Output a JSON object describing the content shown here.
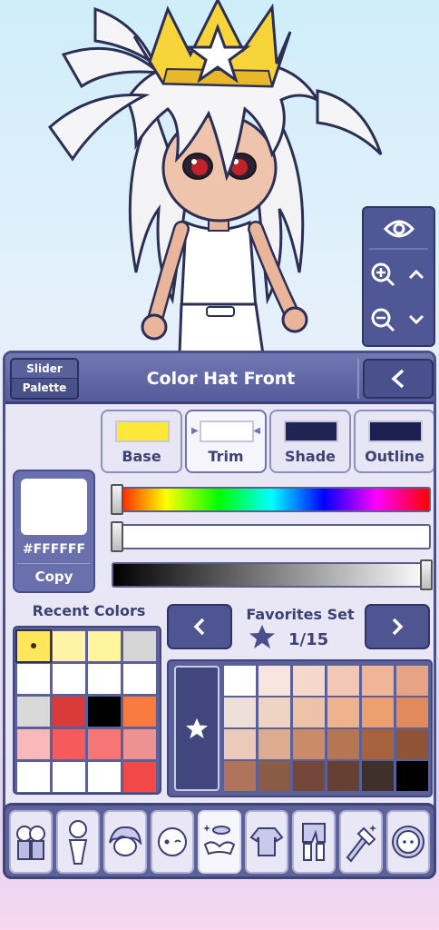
{
  "view_controls": {
    "icons": [
      "eye-icon",
      "zoom-in-icon",
      "chevron-up-icon",
      "zoom-out-icon",
      "chevron-down-icon"
    ]
  },
  "panel": {
    "mode_toggle": {
      "option_top": "Slider",
      "option_bottom": "Palette"
    },
    "title": "Color Hat Front",
    "back_icon": "chevron-left-icon",
    "part_tabs": [
      {
        "label": "Base",
        "color": "#FFE83A"
      },
      {
        "label": "Trim",
        "color": "#FFFFFF"
      },
      {
        "label": "Shade",
        "color": "#1F2550"
      },
      {
        "label": "Outline",
        "color": "#1C2050"
      }
    ],
    "active_part": "Trim",
    "current_color": {
      "hex": "#FFFFFF",
      "copy_label": "Copy"
    },
    "sliders": {
      "hue": 0,
      "saturation": 0,
      "value": 100
    },
    "recent": {
      "title": "Recent Colors",
      "colors": [
        "#FFE65A",
        "#FFF3A8",
        "#FFF59C",
        "#D6D6D6",
        "#FFFFFF",
        "#FFFFFF",
        "#FFFFFF",
        "#FFFFFF",
        "#D9D9D9",
        "#D93B3B",
        "#000000",
        "#F97B3F",
        "#F7B9B9",
        "#F65A5A",
        "#F77575",
        "#EE9191",
        "#FFFFFF",
        "#FFFFFF",
        "#FFFFFF",
        "#F14848"
      ]
    },
    "favorites": {
      "title": "Favorites Set",
      "page": "1/15",
      "prev_icon": "chevron-left-icon",
      "next_icon": "chevron-right-icon",
      "colors": [
        "#FFFFFF",
        "#F8E5DF",
        "#F4D8CC",
        "#F2C7B3",
        "#EFB596",
        "#E7A386",
        "#EEE0D9",
        "#EFD3C3",
        "#EDC3A8",
        "#EEB28C",
        "#ED9F70",
        "#E18A5C",
        "#ECCABA",
        "#DDAC8E",
        "#C98B69",
        "#B77653",
        "#A8633E",
        "#8F5337",
        "#B0745A",
        "#8A5C46",
        "#73473A",
        "#654033",
        "#3F302C",
        "#000000"
      ]
    }
  },
  "toolbar": {
    "tools": [
      "presets-icon",
      "body-icon",
      "hair-icon",
      "face-icon",
      "accessories-icon",
      "top-clothing-icon",
      "bottom-clothing-icon",
      "props-icon",
      "profile-icon"
    ],
    "active_tool": "accessories-icon"
  }
}
